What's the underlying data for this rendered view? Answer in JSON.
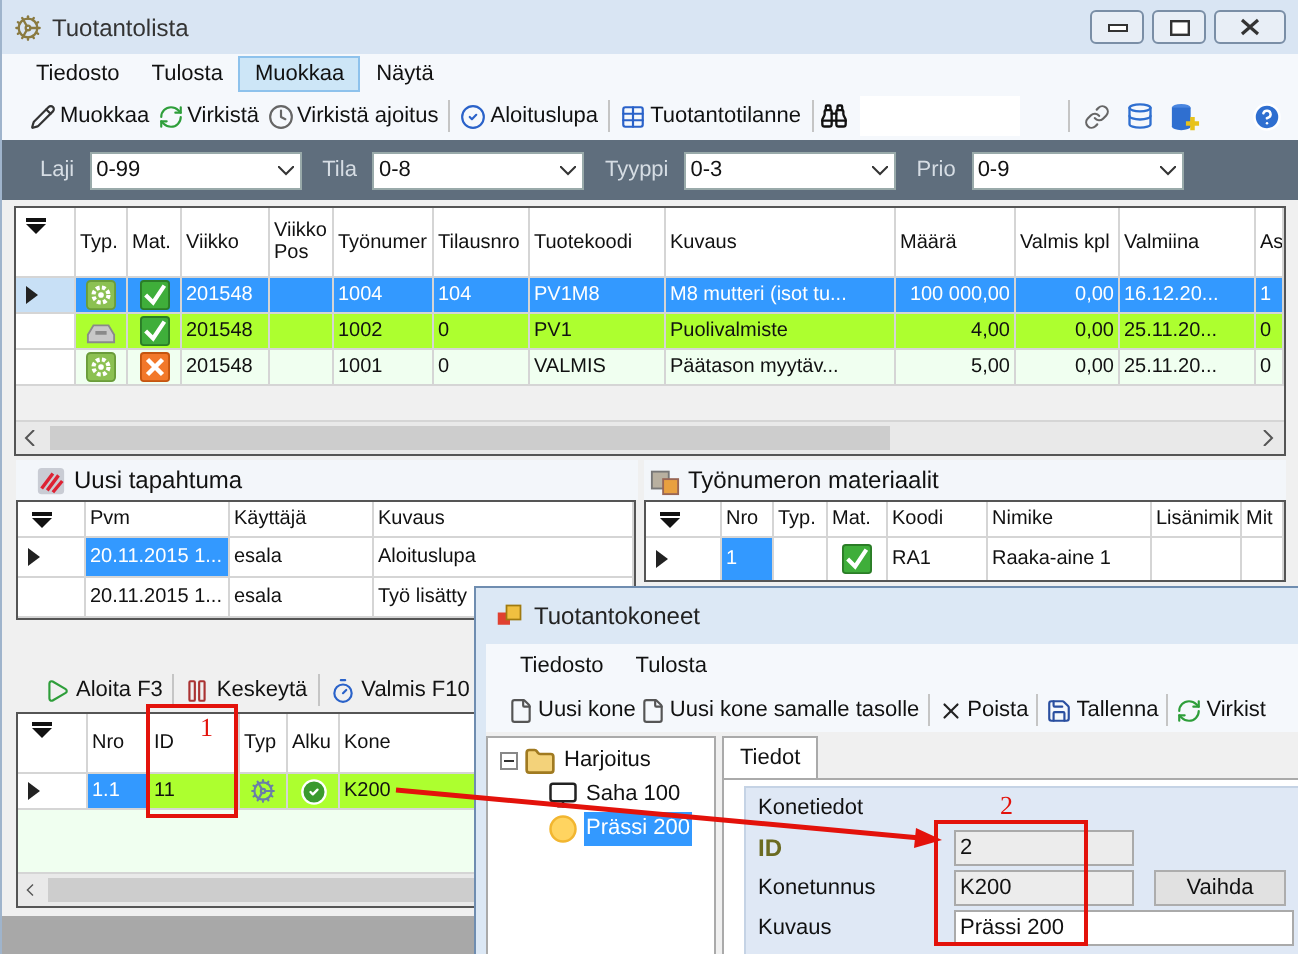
{
  "main_window": {
    "title": "Tuotantolista",
    "menu": [
      {
        "label": "Tiedosto",
        "selected": false
      },
      {
        "label": "Tulosta",
        "selected": false
      },
      {
        "label": "Muokkaa",
        "selected": true
      },
      {
        "label": "Näytä",
        "selected": false
      }
    ],
    "toolbar": [
      [
        "Muokkaa",
        "Virkistä",
        "Virkistä ajoitus"
      ],
      [
        "Aloituslupa"
      ],
      [
        "Tuotantotilanne"
      ]
    ],
    "filters": [
      {
        "label": "Laji",
        "value": "0-99"
      },
      {
        "label": "Tila",
        "value": "0-8"
      },
      {
        "label": "Tyyppi",
        "value": "0-3"
      },
      {
        "label": "Prio",
        "value": "0-9"
      }
    ],
    "work_orders": {
      "columns": [
        "Typ.",
        "Mat.",
        "Viikko",
        "Viikko Pos",
        "Työnumer",
        "Tilausnro",
        "Tuotekoodi",
        "Kuvaus",
        "Määrä",
        "Valmis kpl",
        "Valmiina",
        "As"
      ],
      "rows": [
        {
          "selected": true,
          "color": "#3399ff",
          "kind": "gear",
          "material_ok": true,
          "cells": [
            null,
            null,
            "201548",
            null,
            "1004",
            "104",
            "PV1M8",
            "M8 mutteri (isot tu...",
            "100 000,00",
            "0,00",
            "16.12.20...",
            "1"
          ]
        },
        {
          "selected": false,
          "color": "#adff2f",
          "kind": "tray",
          "material_ok": true,
          "cells": [
            null,
            null,
            "201548",
            null,
            "1002",
            "0",
            "PV1",
            "Puolivalmiste",
            "4,00",
            "0,00",
            "25.11.20...",
            "0"
          ]
        },
        {
          "selected": false,
          "color": "#f0fff0",
          "kind": "gear",
          "material_ok": false,
          "cells": [
            null,
            null,
            "201548",
            null,
            "1001",
            "0",
            "VALMIS",
            "Päätason myytäv...",
            "5,00",
            "0,00",
            "25.11.20...",
            "0"
          ]
        }
      ]
    },
    "events": {
      "title": "Uusi tapahtuma",
      "columns": [
        "Pvm",
        "Käyttäjä",
        "Kuvaus"
      ],
      "rows": [
        {
          "selected": true,
          "cells": [
            "20.11.2015 1...",
            "esala",
            "Aloituslupa"
          ]
        },
        {
          "selected": false,
          "cells": [
            "20.11.2015 1...",
            "esala",
            "Työ lisätty"
          ]
        }
      ]
    },
    "materials": {
      "title": "Työnumeron materiaalit",
      "columns": [
        "Nro",
        "Typ.",
        "Mat.",
        "Koodi",
        "Nimike",
        "Lisänimik",
        "Mit"
      ],
      "rows": [
        {
          "selected": true,
          "material_ok": true,
          "cells": [
            "1",
            null,
            null,
            "RA1",
            "Raaka-aine 1",
            null,
            null
          ]
        }
      ]
    },
    "phases": {
      "toolbar": [
        "Aloita F3",
        "Keskeytä",
        "Valmis F10"
      ],
      "columns": [
        "Nro",
        "ID",
        "Typ",
        "Alku",
        "Kone"
      ],
      "rows": [
        {
          "selected": true,
          "color": "#adff2f",
          "started": true,
          "cells": [
            "1.1",
            "11",
            null,
            null,
            "K200"
          ]
        }
      ]
    }
  },
  "machines_window": {
    "title": "Tuotantokoneet",
    "menu": [
      "Tiedosto",
      "Tulosta"
    ],
    "toolbar": [
      [
        "Uusi kone",
        "Uusi kone samalle tasolle"
      ],
      [
        "Poista"
      ],
      [
        "Tallenna"
      ],
      [
        "Virkist"
      ]
    ],
    "tree": [
      {
        "label": "Harjoitus",
        "kind": "folder",
        "expanded": true,
        "selected": false,
        "children": [
          {
            "label": "Saha 100",
            "kind": "machine",
            "selected": false
          },
          {
            "label": "Prässi 200",
            "kind": "press",
            "selected": true
          }
        ]
      }
    ],
    "tabs": [
      {
        "label": "Tiedot",
        "selected": true
      }
    ],
    "group": "Konetiedot",
    "fields": [
      {
        "label": "ID",
        "value": "2",
        "disabled": true,
        "emphasized": true
      },
      {
        "label": "Konetunnus",
        "value": "K200",
        "disabled": true,
        "emphasized": false,
        "button": "Vaihda"
      },
      {
        "label": "Kuvaus",
        "value": "Prässi 200",
        "disabled": false,
        "emphasized": false
      }
    ]
  },
  "annotations": [
    {
      "label": "1"
    },
    {
      "label": "2"
    }
  ]
}
